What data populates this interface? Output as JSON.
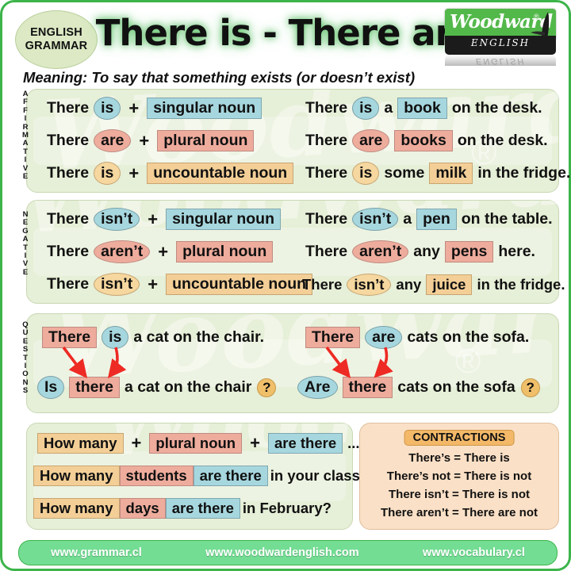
{
  "header": {
    "badge_line1": "ENGLISH",
    "badge_line2": "GRAMMAR",
    "title": "There is - There are",
    "logo_word": "Woodward",
    "logo_reg": "®",
    "logo_sub": "ENGLISH",
    "logo_reflection": "ENGLISH",
    "meaning_label": "Meaning:",
    "meaning_text": "To say that something exists (or doesn’t exist)"
  },
  "watermark": {
    "text": "Woodward",
    "registered": "®"
  },
  "sections": [
    {
      "id": "affirmative",
      "vertical_label": "AFFIRMATIVE",
      "formulas": [
        {
          "there": "There",
          "verb": "is",
          "verb_color": "blue",
          "plus": "+",
          "noun": "singular noun",
          "noun_color": "blue"
        },
        {
          "there": "There",
          "verb": "are",
          "verb_color": "pink",
          "plus": "+",
          "noun": "plural noun",
          "noun_color": "pink"
        },
        {
          "there": "There",
          "verb": "is",
          "verb_color": "orange",
          "plus": "+",
          "noun": "uncountable noun",
          "noun_color": "orange"
        }
      ],
      "examples": [
        {
          "there": "There",
          "verb": "is",
          "verb_color": "blue",
          "mid": "a",
          "noun": "book",
          "noun_color": "blue",
          "tail": "on the desk."
        },
        {
          "there": "There",
          "verb": "are",
          "verb_color": "pink",
          "mid": "",
          "noun": "books",
          "noun_color": "pink",
          "tail": "on the desk."
        },
        {
          "there": "There",
          "verb": "is",
          "verb_color": "orange",
          "mid": "some",
          "noun": "milk",
          "noun_color": "orange",
          "tail": "in the fridge."
        }
      ]
    },
    {
      "id": "negative",
      "vertical_label": "NEGATIVE",
      "formulas": [
        {
          "there": "There",
          "verb": "isn’t",
          "verb_color": "blue",
          "plus": "+",
          "noun": "singular noun",
          "noun_color": "blue"
        },
        {
          "there": "There",
          "verb": "aren’t",
          "verb_color": "pink",
          "plus": "+",
          "noun": "plural noun",
          "noun_color": "pink"
        },
        {
          "there": "There",
          "verb": "isn’t",
          "verb_color": "orange",
          "plus": "+",
          "noun": "uncountable noun",
          "noun_color": "orange"
        }
      ],
      "examples": [
        {
          "there": "There",
          "verb": "isn’t",
          "verb_color": "blue",
          "mid": "a",
          "noun": "pen",
          "noun_color": "blue",
          "tail": "on the table."
        },
        {
          "there": "There",
          "verb": "aren’t",
          "verb_color": "pink",
          "mid": "any",
          "noun": "pens",
          "noun_color": "pink",
          "tail": "here."
        },
        {
          "there": "There",
          "verb": "isn’t",
          "verb_color": "orange",
          "mid": "any",
          "noun": "juice",
          "noun_color": "orange",
          "tail": "in the fridge."
        }
      ]
    }
  ],
  "questions": {
    "vertical_label": "QUESTIONS",
    "left": {
      "statement": {
        "there": "There",
        "verb": "is",
        "tail": "a cat on the chair."
      },
      "question": {
        "verb": "Is",
        "there": "there",
        "tail": "a cat on the chair",
        "qmark": "?"
      }
    },
    "right": {
      "statement": {
        "there": "There",
        "verb": "are",
        "tail": "cats on the sofa."
      },
      "question": {
        "verb": "Are",
        "there": "there",
        "tail": "cats on the sofa",
        "qmark": "?"
      }
    }
  },
  "howmany": {
    "formula": {
      "a": "How many",
      "plus1": "+",
      "b": "plural noun",
      "plus2": "+",
      "c": "are there",
      "tail": "... ?"
    },
    "examples": [
      {
        "a": "How many",
        "b": "students",
        "c": "are there",
        "tail": "in your class?"
      },
      {
        "a": "How many",
        "b": "days",
        "c": "are there",
        "tail": "in February?"
      }
    ]
  },
  "contractions": {
    "title": "CONTRACTIONS",
    "lines": [
      "There’s = There is",
      "There’s not = There is not",
      "There isn’t = There is not",
      "There aren’t = There are not"
    ]
  },
  "footer": {
    "links": [
      "www.grammar.cl",
      "www.woodwardenglish.com",
      "www.vocabulary.cl"
    ]
  },
  "colors": {
    "frame_green": "#3cb44a",
    "section_green": "#e6efd7",
    "blue": "#a7d7de",
    "pink": "#eeac9d",
    "orange": "#f3cf97",
    "contraction_bg": "#fae0c6",
    "footer_bg": "#74dd94",
    "arrow_red": "#ee2a24"
  }
}
